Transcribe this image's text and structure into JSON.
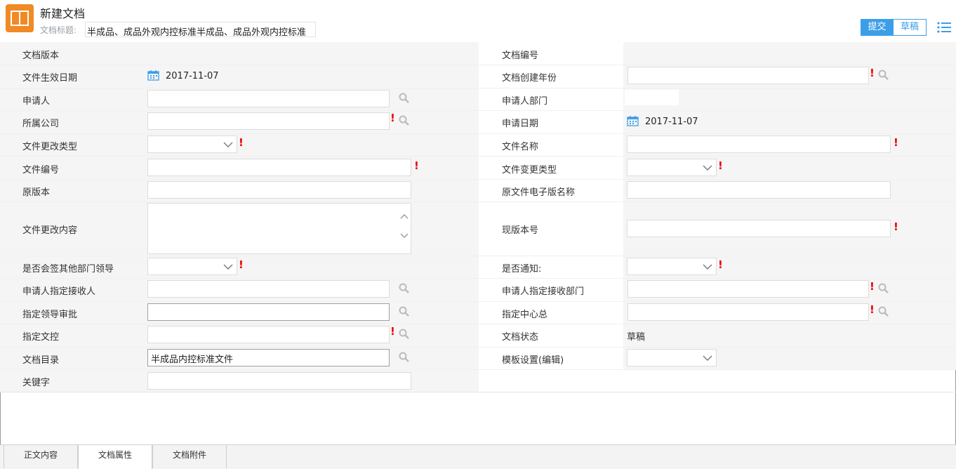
{
  "header": {
    "title": "新建文档",
    "subtitle_label": "文档标题:",
    "subtitle_value": "半成品、成品外观内控标准半成品、成品外观内控标准",
    "submit_label": "提交",
    "draft_label": "草稿",
    "accent_color": "#3d9ee8",
    "icon_color": "#f08a24"
  },
  "form": {
    "doc_version_label": "文档版本",
    "doc_number_label": "文档编号",
    "effective_date_label": "文件生效日期",
    "effective_date_value": "2017-11-07",
    "create_year_label": "文档创建年份",
    "applicant_label": "申请人",
    "applicant_dept_label": "申请人部门",
    "company_label": "所属公司",
    "apply_date_label": "申请日期",
    "apply_date_value": "2017-11-07",
    "change_type_label": "文件更改类型",
    "file_name_label": "文件名称",
    "file_number_label": "文件编号",
    "file_change_type_label": "文件变更类型",
    "orig_version_label": "原版本",
    "orig_file_name_label": "原文件电子版名称",
    "change_content_label": "文件更改内容",
    "current_version_label": "现版本号",
    "countersign_label": "是否会签其他部门领导",
    "notify_label": "是否通知:",
    "receiver_label": "申请人指定接收人",
    "receiver_dept_label": "申请人指定接收部门",
    "leader_approval_label": "指定领导审批",
    "center_head_label": "指定中心总",
    "doc_control_label": "指定文控",
    "doc_status_label": "文档状态",
    "doc_status_value": "草稿",
    "doc_dir_label": "文档目录",
    "doc_dir_value": "半成品内控标准文件",
    "template_label": "模板设置(编辑)",
    "keywords_label": "关键字"
  },
  "tabs": [
    {
      "label": "正文内容"
    },
    {
      "label": "文档属性"
    },
    {
      "label": "文档附件"
    }
  ]
}
